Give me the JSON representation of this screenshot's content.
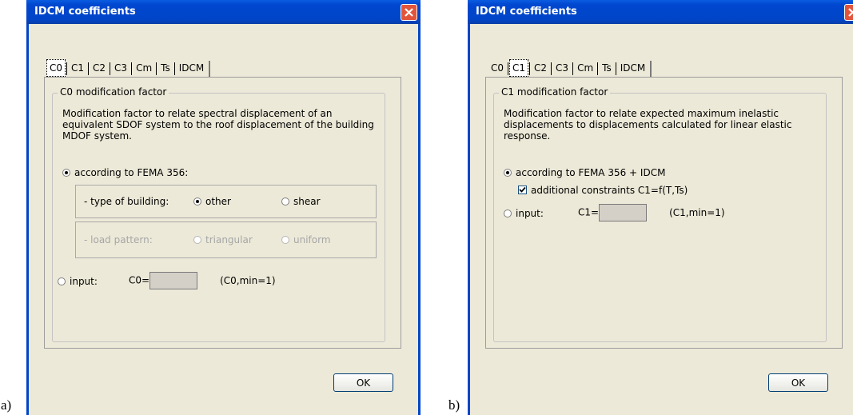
{
  "captions": {
    "a": "a)",
    "b": "b)"
  },
  "dialog_a": {
    "title": "IDCM coefficients",
    "tabs": [
      "C0",
      "C1",
      "C2",
      "C3",
      "Cm",
      "Ts",
      "IDCM"
    ],
    "selected_tab": "C0",
    "group_label": "C0 modification factor",
    "description": "Modification factor to relate spectral displacement of an equivalent SDOF system to the roof displacement of the building MDOF system.",
    "option_fema": "according to FEMA 356:",
    "building_type_label": "- type of building:",
    "building_other": "other",
    "building_shear": "shear",
    "load_pattern_label": "- load pattern:",
    "load_triangular": "triangular",
    "load_uniform": "uniform",
    "option_input": "input:",
    "input_label": "C0=",
    "input_value": "",
    "input_note": "(C0,min=1)",
    "ok_label": "OK"
  },
  "dialog_b": {
    "title": "IDCM coefficients",
    "tabs": [
      "C0",
      "C1",
      "C2",
      "C3",
      "Cm",
      "Ts",
      "IDCM"
    ],
    "selected_tab": "C1",
    "group_label": "C1 modification factor",
    "description": "Modification factor to relate expected maximum inelastic displacements to displacements calculated for linear elastic response.",
    "option_fema": "according to FEMA 356 + IDCM",
    "constraint_label": "additional constraints C1=f(T,Ts)",
    "option_input": "input:",
    "input_label": "C1=",
    "input_value": "",
    "input_note": "(C1,min=1)",
    "ok_label": "OK"
  },
  "colors": {
    "titlebar": "#0045c8",
    "dialog_bg": "#ece9d8",
    "close_button": "#e2553b"
  }
}
